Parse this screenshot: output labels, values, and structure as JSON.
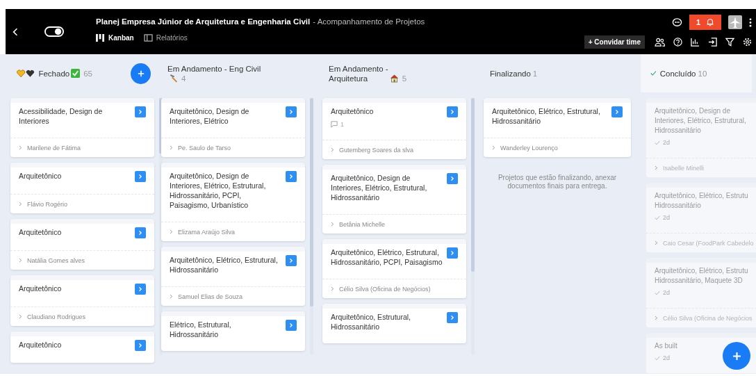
{
  "header": {
    "title": "Planej Empresa Júnior de Arquitetura e Engenharia Civil",
    "subtitle": "- Acompanhamento de Projetos",
    "notifications": "1",
    "invite_button": "+ Convidar time",
    "tabs": [
      {
        "label": "Kanban",
        "selected": true
      },
      {
        "label": "Relatórios",
        "selected": false
      }
    ]
  },
  "columns": [
    {
      "kind": "closed",
      "title": "Fechado",
      "count": "65",
      "cards": [
        {
          "title": "Acessibilidade, Design de Interiores",
          "assignee": "Marilene de Fátima"
        },
        {
          "title": "Arquitetônico",
          "assignee": "Flávio Rogério"
        },
        {
          "title": "Arquitetônico",
          "assignee": "Natália Gomes alves"
        },
        {
          "title": "Arquitetônico",
          "assignee": "Claudiano Rodrigues"
        },
        {
          "title": "Arquitetônico"
        }
      ]
    },
    {
      "kind": "civil",
      "title": "Em Andamento - Eng Civil",
      "count": "4",
      "cards": [
        {
          "title": "Arquitetônico, Design de Interiores, Elétrico",
          "assignee": "Pe. Saulo de Tarso"
        },
        {
          "title": "Arquitetônico, Design de Interiores, Elétrico, Estrutural, Hidrossanitário, PCPI, Paisagismo, Urbanístico",
          "assignee": "Elizama Araújo Silva"
        },
        {
          "title": "Arquitetônico, Elétrico, Estrutural, Hidrossanitário",
          "assignee": "Samuel Elias de Souza"
        },
        {
          "title": "Elétrico, Estrutural, Hidrossanitário"
        }
      ]
    },
    {
      "kind": "architecture",
      "title": "Em Andamento -\nArquitetura",
      "count": "5",
      "cards": [
        {
          "title": "Arquitetônico",
          "comments": "1",
          "assignee": "Gutemberg Soares da slva"
        },
        {
          "title": "Arquitetônico, Design de Interiores, Elétrico, Estrutural, Hidrossanitário",
          "assignee": "Betânia Michelle"
        },
        {
          "title": "Arquitetônico, Elétrico, Estrutural, Hidrossanitário, PCPI, Paisagismo",
          "assignee": "Célio Silva (Oficina de Negócios)"
        },
        {
          "title": "Arquitetônico, Estrutural, Hidrossanitário"
        }
      ]
    },
    {
      "kind": "finishing",
      "title": "Finalizando",
      "count": "1",
      "note": "Projetos que estão finalizando, anexar documentos finais para entrega.",
      "cards": [
        {
          "title": "Arquitetônico, Elétrico, Estrutural, Hidrossanitário",
          "assignee": "Wanderley Lourenço"
        }
      ]
    },
    {
      "kind": "done",
      "title": "Concluído",
      "count": "10",
      "cards": [
        {
          "title": "Arquitetônico, Design de\nInteriores, Elétrico, Estrutural,\nHidrossanitário",
          "elapsed": "2d",
          "assignee": "Isabelle Minelli"
        },
        {
          "title": "Arquitetônico, Elétrico, Estrutu\nHidrossanitário",
          "elapsed": "2d",
          "assignee": "Caio Cesar (FoodPark Cabedelo"
        },
        {
          "title": "Arquitetônico, Elétrico, Estrutu\nHidrossanitário, Maquete 3D",
          "elapsed": "2d",
          "assignee": "Célio Silva (Oficina de Negócios"
        },
        {
          "title": "As built",
          "elapsed": "2d"
        }
      ]
    }
  ]
}
